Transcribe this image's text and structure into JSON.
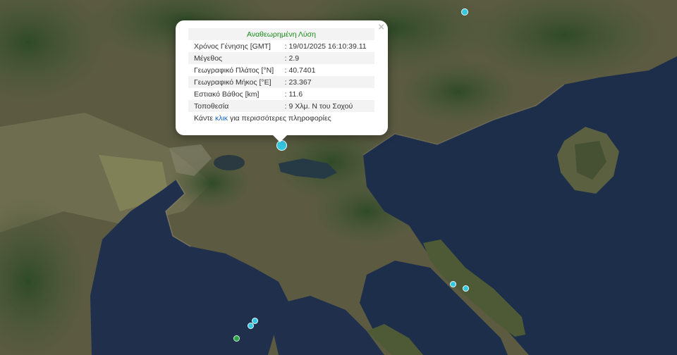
{
  "popup": {
    "title": "Αναθεωρημένη Λύση",
    "close_glyph": "×",
    "rows": [
      {
        "label": "Χρόνος Γένησης [GMT]",
        "value": ": 19/01/2025 16:10:39.11"
      },
      {
        "label": "Μέγεθος",
        "value": ": 2.9"
      },
      {
        "label": "Γεωγραφικό Πλάτος [°N]",
        "value": ": 40.7401"
      },
      {
        "label": "Γεωγραφικό Μήκος [°E]",
        "value": ": 23.367"
      },
      {
        "label": "Εστιακό Βάθος [km]",
        "value": ": 11.6"
      },
      {
        "label": "Τοποθεσία",
        "value": ": 9 Χλμ. Ν του Σοχού"
      }
    ],
    "more_prefix": "Κάντε ",
    "more_link": "κλικ",
    "more_suffix": " για περισσότερες πληροφορίες"
  },
  "colors": {
    "sea": "#1d2e4a",
    "land": "#5a5a40",
    "marker_cyan": "#35c6e0",
    "marker_green": "#2fa34a",
    "popup_title": "#1a8a1a",
    "link": "#1565c0"
  },
  "markers": [
    {
      "name": "selected-earthquake",
      "color": "cyan"
    },
    {
      "name": "earthquake-north",
      "color": "cyan"
    },
    {
      "name": "earthquake-kassandra",
      "color": "cyan"
    },
    {
      "name": "earthquake-kassandra-2",
      "color": "cyan"
    },
    {
      "name": "earthquake-sithonia",
      "color": "cyan"
    },
    {
      "name": "earthquake-sithonia-2",
      "color": "cyan"
    },
    {
      "name": "earthquake-gulf",
      "color": "green"
    }
  ]
}
